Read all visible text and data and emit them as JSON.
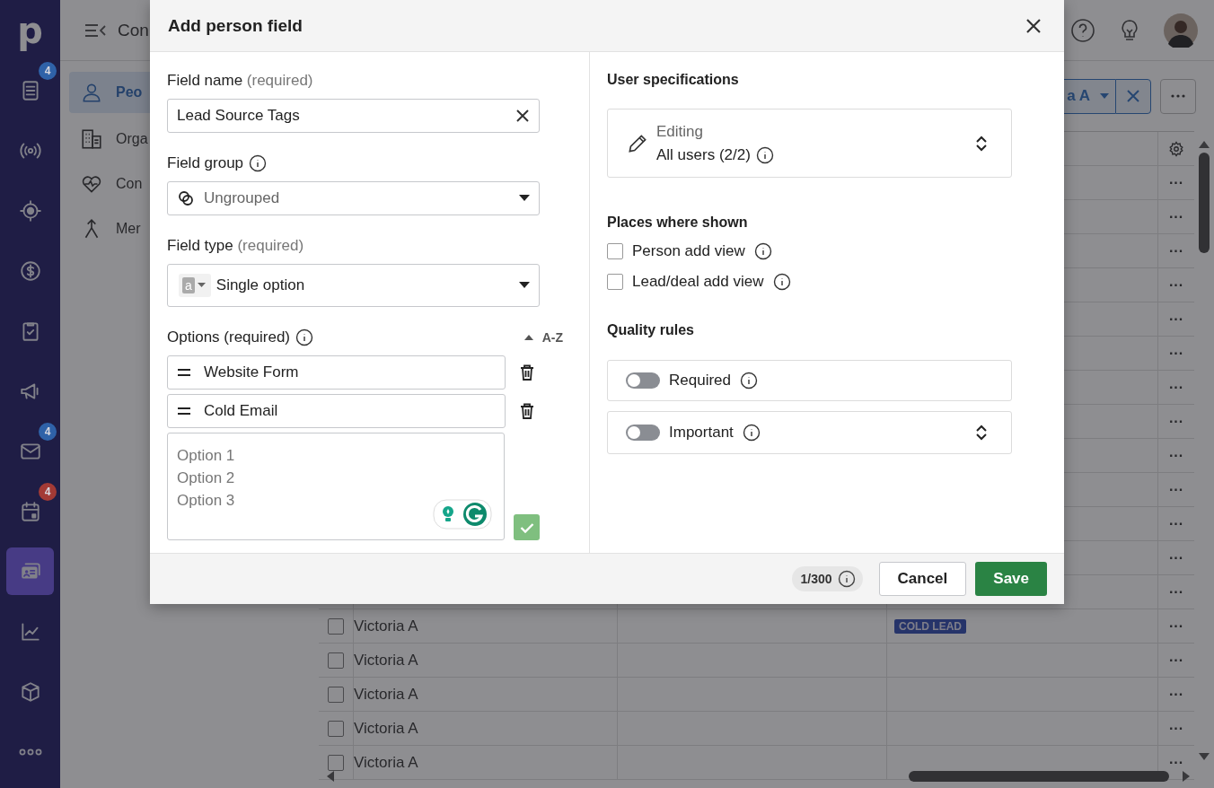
{
  "sidebar": {
    "logo": "p",
    "items": [
      {
        "kind": "list",
        "badge": {
          "label": "4",
          "color": "#2f62a8"
        },
        "selected": false
      },
      {
        "kind": "broadcast",
        "selected": false
      },
      {
        "kind": "target",
        "selected": false
      },
      {
        "kind": "dollar",
        "selected": false
      },
      {
        "kind": "clipboard",
        "selected": false
      },
      {
        "kind": "megaphone",
        "selected": false
      },
      {
        "kind": "mail",
        "badge": {
          "label": "4",
          "color": "#2f62a8"
        },
        "selected": false
      },
      {
        "kind": "calendar",
        "badge": {
          "label": "4",
          "color": "#a33a35"
        },
        "selected": false
      },
      {
        "kind": "contacts",
        "selected": true
      },
      {
        "kind": "chart",
        "selected": false
      },
      {
        "kind": "box",
        "selected": false
      },
      {
        "kind": "more",
        "selected": false
      }
    ]
  },
  "topbar": {
    "title": "Con"
  },
  "subnav": [
    {
      "kind": "person",
      "label": "Peo",
      "selected": true
    },
    {
      "kind": "building",
      "label": "Orga",
      "selected": false
    },
    {
      "kind": "heart",
      "label": "Con",
      "selected": false
    },
    {
      "kind": "merge",
      "label": "Mer",
      "selected": false
    }
  ],
  "toolbar": {
    "filter_label": "a A"
  },
  "table": {
    "rows": [
      {
        "menu": "···"
      },
      {
        "menu": "···"
      },
      {
        "menu": "···"
      },
      {
        "menu": "···"
      },
      {
        "menu": "···"
      },
      {
        "menu": "···"
      },
      {
        "menu": "···"
      },
      {
        "menu": "···"
      },
      {
        "menu": "···"
      },
      {
        "menu": "···"
      },
      {
        "menu": "···"
      },
      {
        "menu": "···"
      },
      {
        "menu": "···"
      },
      {
        "name": "Victoria A",
        "checked": false,
        "tag": "COLD LEAD",
        "menu": "···"
      },
      {
        "name": "Victoria A",
        "checked": false,
        "menu": "···"
      },
      {
        "name": "Victoria A",
        "checked": false,
        "menu": "···"
      },
      {
        "name": "Victoria A",
        "checked": false,
        "menu": "···"
      },
      {
        "name": "Victoria A",
        "checked": false,
        "menu": "···"
      }
    ]
  },
  "modal": {
    "title": "Add person field",
    "field_name": {
      "label": "Field name",
      "hint": "(required)",
      "value": "Lead Source Tags"
    },
    "field_group": {
      "label": "Field group",
      "value": "Ungrouped"
    },
    "field_type": {
      "label": "Field type",
      "hint": "(required)",
      "icon_letter": "a",
      "value": "Single option"
    },
    "options": {
      "label": "Options (required)",
      "sort_label": "A-Z",
      "items": [
        {
          "value": "Website Form"
        },
        {
          "value": "Cold Email"
        }
      ],
      "placeholder": "Option 1\nOption 2\nOption 3"
    },
    "user_specs": {
      "title": "User specifications",
      "caption": "Editing",
      "value": "All users (2/2)"
    },
    "places": {
      "title": "Places where shown",
      "items": [
        {
          "label": "Person add view",
          "checked": false
        },
        {
          "label": "Lead/deal add view",
          "checked": false
        }
      ]
    },
    "quality": {
      "title": "Quality rules",
      "items": [
        {
          "label": "Required",
          "on": false,
          "expandable": false
        },
        {
          "label": "Important",
          "on": false,
          "expandable": true
        }
      ]
    },
    "footer": {
      "counter": "1/300",
      "cancel": "Cancel",
      "save": "Save"
    }
  }
}
